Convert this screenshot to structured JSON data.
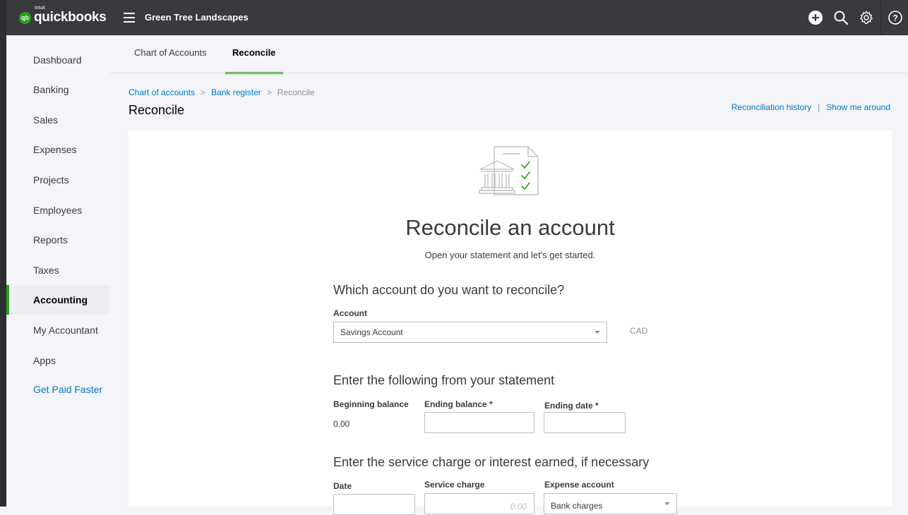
{
  "brand": {
    "badge": "qb",
    "intuit": "intuit",
    "name": "quickbooks"
  },
  "company": "Green Tree Landscapes",
  "top_icons": [
    "plus-circle-icon",
    "search-icon",
    "gear-icon",
    "help-icon"
  ],
  "sidebar": {
    "items": [
      {
        "label": "Dashboard"
      },
      {
        "label": "Banking"
      },
      {
        "label": "Sales"
      },
      {
        "label": "Expenses"
      },
      {
        "label": "Projects"
      },
      {
        "label": "Employees"
      },
      {
        "label": "Reports"
      },
      {
        "label": "Taxes"
      },
      {
        "label": "Accounting",
        "active": true
      },
      {
        "label": "My Accountant"
      },
      {
        "label": "Apps"
      },
      {
        "label": "Get Paid Faster",
        "promo": true
      }
    ]
  },
  "tabs": [
    {
      "label": "Chart of Accounts"
    },
    {
      "label": "Reconcile",
      "active": true
    }
  ],
  "breadcrumb": {
    "items": [
      "Chart of accounts",
      "Bank register",
      "Reconcile"
    ],
    "separator": ">"
  },
  "page_title": "Reconcile",
  "header_links": {
    "history": "Reconciliation history",
    "separator": "|",
    "tour": "Show me around"
  },
  "card": {
    "title": "Reconcile an account",
    "subtitle": "Open your statement and let's get started.",
    "section1": {
      "heading": "Which account do you want to reconcile?",
      "account_label": "Account",
      "account_value": "Savings Account",
      "currency": "CAD"
    },
    "section2": {
      "heading": "Enter the following from your statement",
      "beginning_label": "Beginning balance",
      "beginning_value": "0.00",
      "ending_balance_label": "Ending balance *",
      "ending_date_label": "Ending date *"
    },
    "section3": {
      "heading": "Enter the service charge or interest earned, if necessary",
      "date_label": "Date",
      "service_charge_label": "Service charge",
      "service_charge_placeholder": "0.00",
      "expense_account_label": "Expense account",
      "expense_account_value": "Bank charges"
    }
  },
  "colors": {
    "topbar": "#393a3d",
    "accent_green": "#2ca01c",
    "link_blue": "#0077c5"
  }
}
